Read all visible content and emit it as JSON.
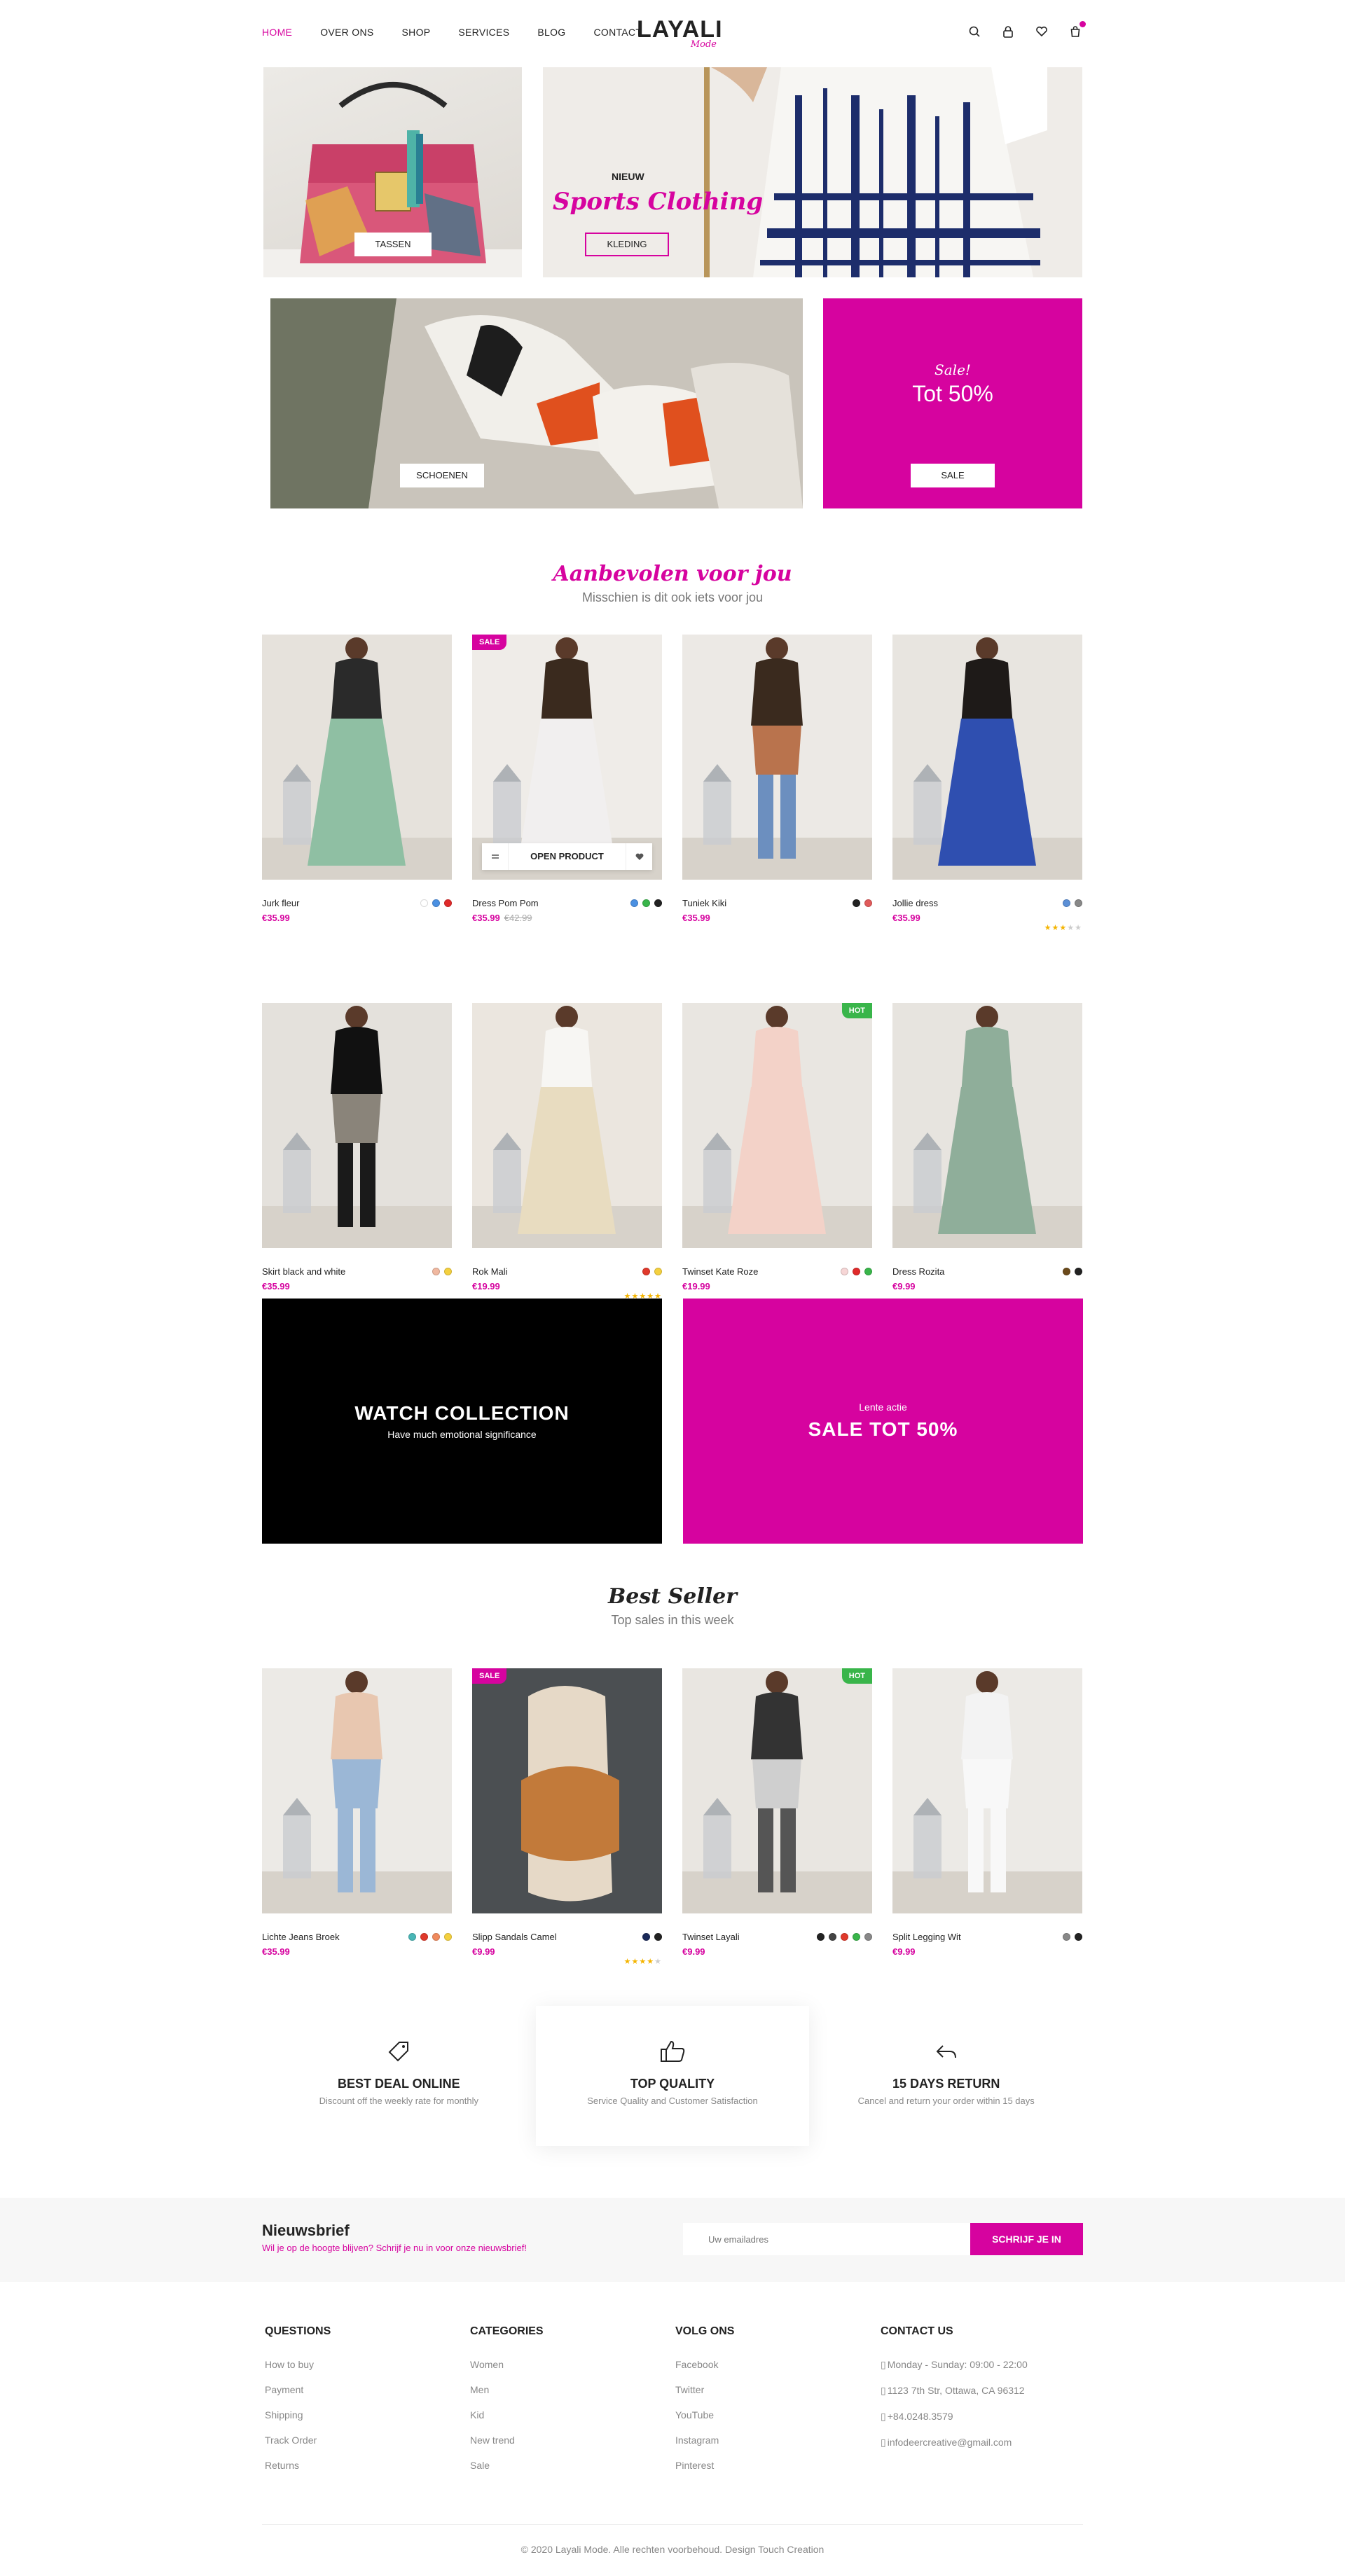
{
  "colors": {
    "accent": "#d6039f",
    "hot": "#39b54a",
    "text": "#222222"
  },
  "nav": {
    "items": [
      "HOME",
      "OVER ONS",
      "SHOP",
      "SERVICES",
      "BLOG",
      "CONTACT"
    ],
    "active": "HOME"
  },
  "logo": {
    "main": "LAYALI",
    "sub": "Mode"
  },
  "header_icons": [
    "search-icon",
    "lock-icon",
    "heart-icon",
    "cart-icon"
  ],
  "banners": {
    "bags": {
      "label": "TASSEN"
    },
    "clothing": {
      "kicker": "NIEUW",
      "script": "Sports Clothing",
      "label": "KLEDING"
    },
    "shoes": {
      "label": "SCHOENEN"
    },
    "sale": {
      "script": "Sale!",
      "headline": "Tot 50%",
      "label": "SALE"
    }
  },
  "recommended": {
    "title": "Aanbevolen voor jou",
    "subtitle": "Misschien is dit ook iets voor jou",
    "hover_button": "OPEN PRODUCT",
    "products": [
      {
        "name": "Jurk fleur",
        "price": "€35.99",
        "old_price": "",
        "tag": "",
        "swatches": [
          "#ffffff",
          "#4a90e2",
          "#e02a2a"
        ],
        "rating": 0
      },
      {
        "name": "Dress Pom Pom",
        "price": "€35.99",
        "old_price": "€42.99",
        "tag": "SALE",
        "swatches": [
          "#4a90e2",
          "#39b54a",
          "#222222"
        ],
        "rating": 0
      },
      {
        "name": "Tuniek Kiki",
        "price": "€35.99",
        "old_price": "",
        "tag": "",
        "swatches": [
          "#222222",
          "#e05a5a"
        ],
        "rating": 0
      },
      {
        "name": "Jollie dress",
        "price": "€35.99",
        "old_price": "",
        "tag": "",
        "swatches": [
          "#5b8fd6",
          "#888888"
        ],
        "rating": 3
      },
      {
        "name": "Skirt black and white",
        "price": "€35.99",
        "old_price": "",
        "tag": "",
        "swatches": [
          "#f0b8a0",
          "#f4d03f"
        ],
        "rating": 0
      },
      {
        "name": "Rok Mali",
        "price": "€19.99",
        "old_price": "",
        "tag": "",
        "swatches": [
          "#e0392b",
          "#f4d03f"
        ],
        "rating": 5
      },
      {
        "name": "Twinset Kate Roze",
        "price": "€19.99",
        "old_price": "",
        "tag": "HOT",
        "swatches": [
          "#f6d6d6",
          "#e02a2a",
          "#39b54a"
        ],
        "rating": 0
      },
      {
        "name": "Dress Rozita",
        "price": "€9.99",
        "old_price": "",
        "tag": "",
        "swatches": [
          "#6b4a1b",
          "#222222"
        ],
        "rating": 0
      }
    ]
  },
  "promos": {
    "watch": {
      "title": "WATCH COLLECTION",
      "subtitle": "Have much emotional significance"
    },
    "sale": {
      "kicker": "Lente actie",
      "title": "SALE TOT 50%"
    }
  },
  "best_seller": {
    "title": "Best Seller",
    "subtitle": "Top sales in this week",
    "products": [
      {
        "name": "Lichte Jeans Broek",
        "price": "€35.99",
        "tag": "",
        "swatches": [
          "#49b6b6",
          "#e0392b",
          "#f08a5d",
          "#f4d03f"
        ],
        "rating": 0
      },
      {
        "name": "Slipp Sandals Camel",
        "price": "€9.99",
        "tag": "SALE",
        "swatches": [
          "#1a2a5a",
          "#222222"
        ],
        "rating": 4
      },
      {
        "name": "Twinset Layali",
        "price": "€9.99",
        "tag": "HOT",
        "swatches": [
          "#222222",
          "#444444",
          "#e0392b",
          "#39b54a",
          "#888888"
        ],
        "rating": 0
      },
      {
        "name": "Split Legging Wit",
        "price": "€9.99",
        "tag": "",
        "swatches": [
          "#888888",
          "#222222"
        ],
        "rating": 0
      }
    ]
  },
  "features": [
    {
      "icon": "tag-icon",
      "title": "BEST DEAL ONLINE",
      "subtitle": "Discount off the weekly rate for monthly"
    },
    {
      "icon": "thumbs-up-icon",
      "title": "TOP QUALITY",
      "subtitle": "Service Quality and Customer Satisfaction"
    },
    {
      "icon": "return-arrow-icon",
      "title": "15 DAYS RETURN",
      "subtitle": "Cancel and return your order within 15 days"
    }
  ],
  "newsletter": {
    "title": "Nieuwsbrief",
    "subtitle": "Wil je op de hoogte blijven? Schrijf je nu in voor onze nieuwsbrief!",
    "placeholder": "Uw emailadres",
    "button": "SCHRIJF JE IN"
  },
  "footer": {
    "columns": [
      {
        "heading": "QUESTIONS",
        "links": [
          "How to buy",
          "Payment",
          "Shipping",
          "Track Order",
          "Returns"
        ]
      },
      {
        "heading": "CATEGORIES",
        "links": [
          "Women",
          "Men",
          "Kid",
          "New trend",
          "Sale"
        ]
      },
      {
        "heading": "VOLG ONS",
        "links": [
          "Facebook",
          "Twitter",
          "YouTube",
          "Instagram",
          "Pinterest"
        ]
      },
      {
        "heading": "CONTACT US",
        "links": [
          "Monday - Sunday: 09:00 - 22:00",
          "1123 7th Str, Ottawa, CA 96312",
          "+84.0248.3579",
          "infodeercreative@gmail.com"
        ]
      }
    ],
    "copyright": "© 2020 Layali Mode. Alle rechten voorbehoud. Design Touch Creation"
  }
}
